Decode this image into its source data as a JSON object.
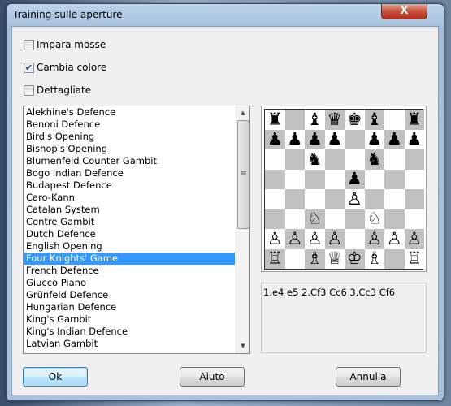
{
  "window": {
    "title": "Training sulle aperture",
    "close_label": "X"
  },
  "options": [
    {
      "label": "Impara mosse",
      "checked": false
    },
    {
      "label": "Cambia colore",
      "checked": true
    },
    {
      "label": "Dettagliate",
      "checked": false
    }
  ],
  "openings": {
    "items": [
      "Alekhine's Defence",
      "Benoni Defence",
      "Bird's Opening",
      "Bishop's Opening",
      "Blumenfeld Counter Gambit",
      "Bogo Indian Defence",
      "Budapest Defence",
      "Caro-Kann",
      "Catalan System",
      "Centre Gambit",
      "Dutch Defence",
      "English Opening",
      "Four Knights' Game",
      "French Defence",
      "Giucco Piano",
      "Grünfeld Defence",
      "Hungarian Defence",
      "King's Gambit",
      "King's Indian Defence",
      "Latvian Gambit"
    ],
    "selected": "Four Knights' Game"
  },
  "board": {
    "ranks": [
      "r.bqkb.r",
      "pppp.ppp",
      "..n..n..",
      "....p...",
      "....P...",
      "..N..N..",
      "PPPP.PPP",
      "R.BQKB.R"
    ],
    "light": "#ffffff",
    "dark": "#c0c0c0"
  },
  "moves": "1.e4 e5 2.Cf3 Cc6 3.Cc3 Cf6",
  "buttons": {
    "ok": "Ok",
    "help": "Aiuto",
    "cancel": "Annulla"
  }
}
